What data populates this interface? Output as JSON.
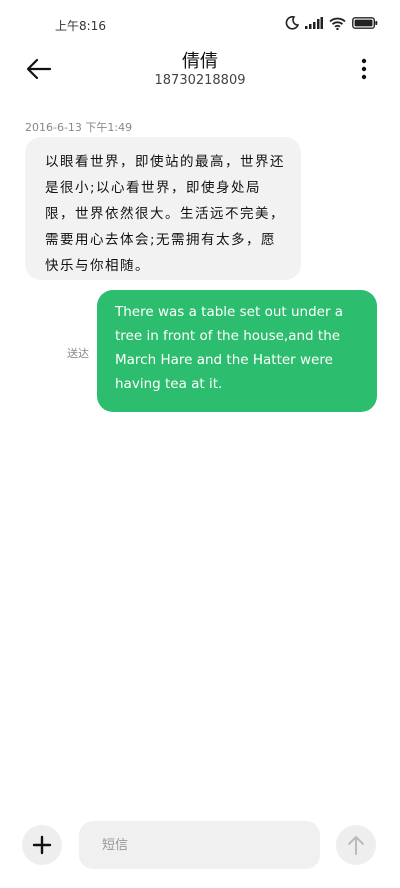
{
  "status_bar": {
    "time": "上午8:16",
    "icons": [
      "moon-icon",
      "signal-icon",
      "wifi-icon",
      "battery-icon"
    ]
  },
  "header": {
    "contact_name": "倩倩",
    "contact_number": "18730218809",
    "back_icon": "back-arrow-icon",
    "more_icon": "more-vertical-icon"
  },
  "conversation": {
    "timestamp": "2016-6-13 下午1:49",
    "incoming_message": "以眼看世界，即使站的最高，世界还是很小;以心看世界，即使身处局限，世界依然很大。生活远不完美，需要用心去体会;无需拥有太多，愿快乐与你相随。",
    "outgoing_status": "送达",
    "outgoing_message": "There was a table set out under a tree in front of the house,and the March Hare and the Hatter were having tea at it."
  },
  "composer": {
    "placeholder": "短信",
    "add_icon": "plus-icon",
    "send_icon": "send-arrow-up-icon"
  },
  "colors": {
    "outgoing_bubble": "#2dbd6e",
    "incoming_bubble": "#f2f2f2"
  }
}
